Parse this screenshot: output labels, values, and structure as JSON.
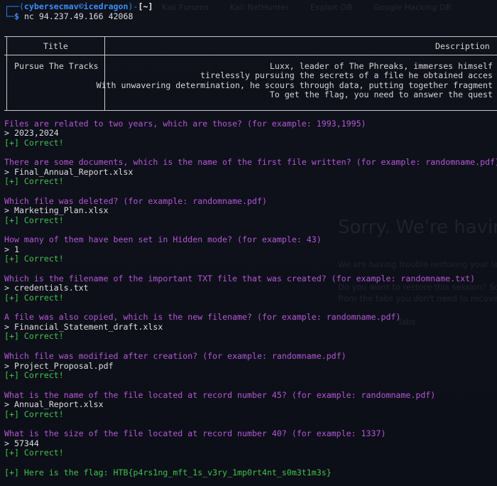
{
  "prompt": {
    "user_host": "cybersecmav©icedragon",
    "directory": "[~]",
    "command": "nc 94.237.49.166 42068"
  },
  "background_ghost": {
    "tabs": [
      "Kali Forums",
      "Kali NetHunter",
      "Exploit-DB",
      "Google Hacking DB"
    ],
    "headline": "Sorry. We're havin",
    "para1": "We are having trouble restoring your las",
    "para2": "Do you want to restore this session? So",
    "para3": "from the tabs you don't need to recover.",
    "para4": "Tabs"
  },
  "table": {
    "col_title": "Title",
    "col_description": "Description",
    "row_title": "Pursue The Tracks",
    "description_lines": [
      "Luxx, leader of The Phreaks, immerses himself",
      "tirelessly pursuing the secrets of a file he obtained acces",
      "With unwavering determination, he scours through data, putting together fragment",
      "To get the flag, you need to answer the quest"
    ]
  },
  "qa": [
    {
      "q": "Files are related to two years, which are those? (for example: 1993,1995)",
      "a": "> 2023,2024",
      "r": "[+] Correct!"
    },
    {
      "q": "There are some documents, which is the name of the first file written? (for example: randomname.pdf)",
      "a": "> Final_Annual_Report.xlsx",
      "r": "[+] Correct!"
    },
    {
      "q": "Which file was deleted? (for example: randomname.pdf)",
      "a": "> Marketing_Plan.xlsx",
      "r": "[+] Correct!"
    },
    {
      "q": "How many of them have been set in Hidden mode? (for example: 43)",
      "a": "> 1",
      "r": "[+] Correct!"
    },
    {
      "q": "Which is the filename of the important TXT file that was created? (for example: randomname.txt)",
      "a": "> credentials.txt",
      "r": "[+] Correct!"
    },
    {
      "q": "A file was also copied, which is the new filename? (for example: randomname.pdf)",
      "a": "> Financial_Statement_draft.xlsx",
      "r": "[+] Correct!"
    },
    {
      "q": "Which file was modified after creation? (for example: randomname.pdf)",
      "a": "> Project_Proposal.pdf",
      "r": "[+] Correct!"
    },
    {
      "q": "What is the name of the file located at record number 45? (for example: randomname.pdf)",
      "a": "> Annual_Report.xlsx",
      "r": "[+] Correct!"
    },
    {
      "q": "What is the size of the file located at record number 40? (for example: 1337)",
      "a": "> 57344",
      "r": "[+] Correct!"
    }
  ],
  "flag_line": "[+] Here is the flag: HTB{p4rs1ng_mft_1s_v3ry_1mp0rt4nt_s0m3t1m3s}",
  "colors": {
    "background": "#0e1019",
    "prompt_blue": "#3a8ef6",
    "question_purple": "#b357d6",
    "correct_green": "#3ec24a",
    "text": "#dcdcdc"
  }
}
